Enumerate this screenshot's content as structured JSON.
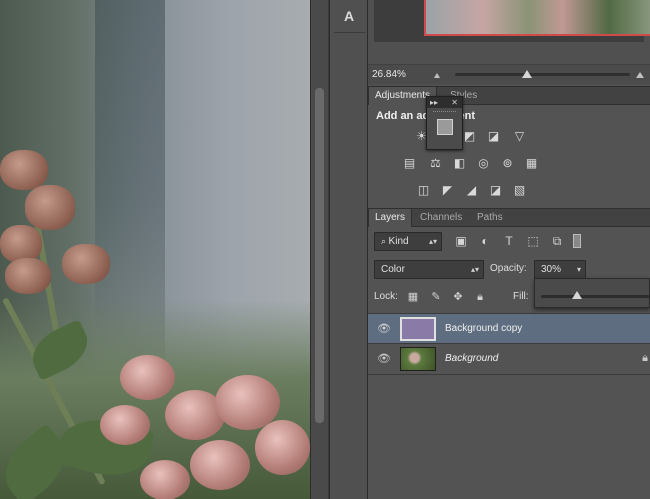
{
  "toolbar": {
    "char_tool": "A"
  },
  "navigator": {
    "zoom": "26.84%"
  },
  "adjustments": {
    "tabs": [
      {
        "label": "Adjustments"
      },
      {
        "label": "Styles"
      }
    ],
    "title": "Add an adjustment",
    "float_controls": {
      "collapse": "▸▸",
      "close": "✕"
    },
    "icons_row1": [
      "☀",
      "▥",
      "◪",
      "◩",
      "▽"
    ],
    "icons_row2": [
      "▤",
      "⚖",
      "◧",
      "◎",
      "⊚",
      "▦"
    ],
    "icons_row3": [
      "◫",
      "◤",
      "◢",
      "◪",
      "▧"
    ]
  },
  "layers": {
    "tabs": [
      {
        "label": "Layers"
      },
      {
        "label": "Channels"
      },
      {
        "label": "Paths"
      }
    ],
    "kind_filter": "Kind",
    "blend_mode": "Color",
    "opacity_label": "Opacity:",
    "opacity_value": "30%",
    "lock_label": "Lock:",
    "fill_label": "Fill:",
    "items": [
      {
        "name": "Background copy",
        "thumb_color": "#8a7aa8",
        "selected": true
      },
      {
        "name": "Background",
        "italic": true,
        "locked": true
      }
    ]
  },
  "colors": {
    "accent_selected": "#5f6d80",
    "navigator_frame": "#d14a4a"
  }
}
